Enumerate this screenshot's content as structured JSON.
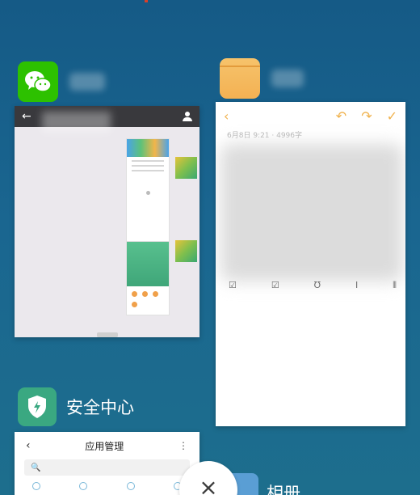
{
  "cards": {
    "wechat": {
      "back_glyph": "←"
    },
    "notes": {
      "meta": "6月8日 9:21 · 4996字",
      "toolbar": {
        "back_glyph": "‹",
        "undo_glyph": "↶",
        "redo_glyph": "↷",
        "confirm_glyph": "✓"
      },
      "format_icons": [
        "☑",
        "☑",
        "Ʊ",
        "I",
        "⦀"
      ]
    },
    "security": {
      "app_title": "安全中心",
      "screen_title": "应用管理",
      "back_glyph": "‹",
      "more_glyph": "⋮",
      "search_glyph": "🔍"
    },
    "gallery": {
      "app_title": "相册"
    }
  },
  "close_button": {
    "glyph": "×"
  },
  "colors": {
    "background": "#1a6690",
    "wechat_green": "#2dc100",
    "notes_accent": "#f0b24d",
    "security_green": "#3aa881"
  }
}
